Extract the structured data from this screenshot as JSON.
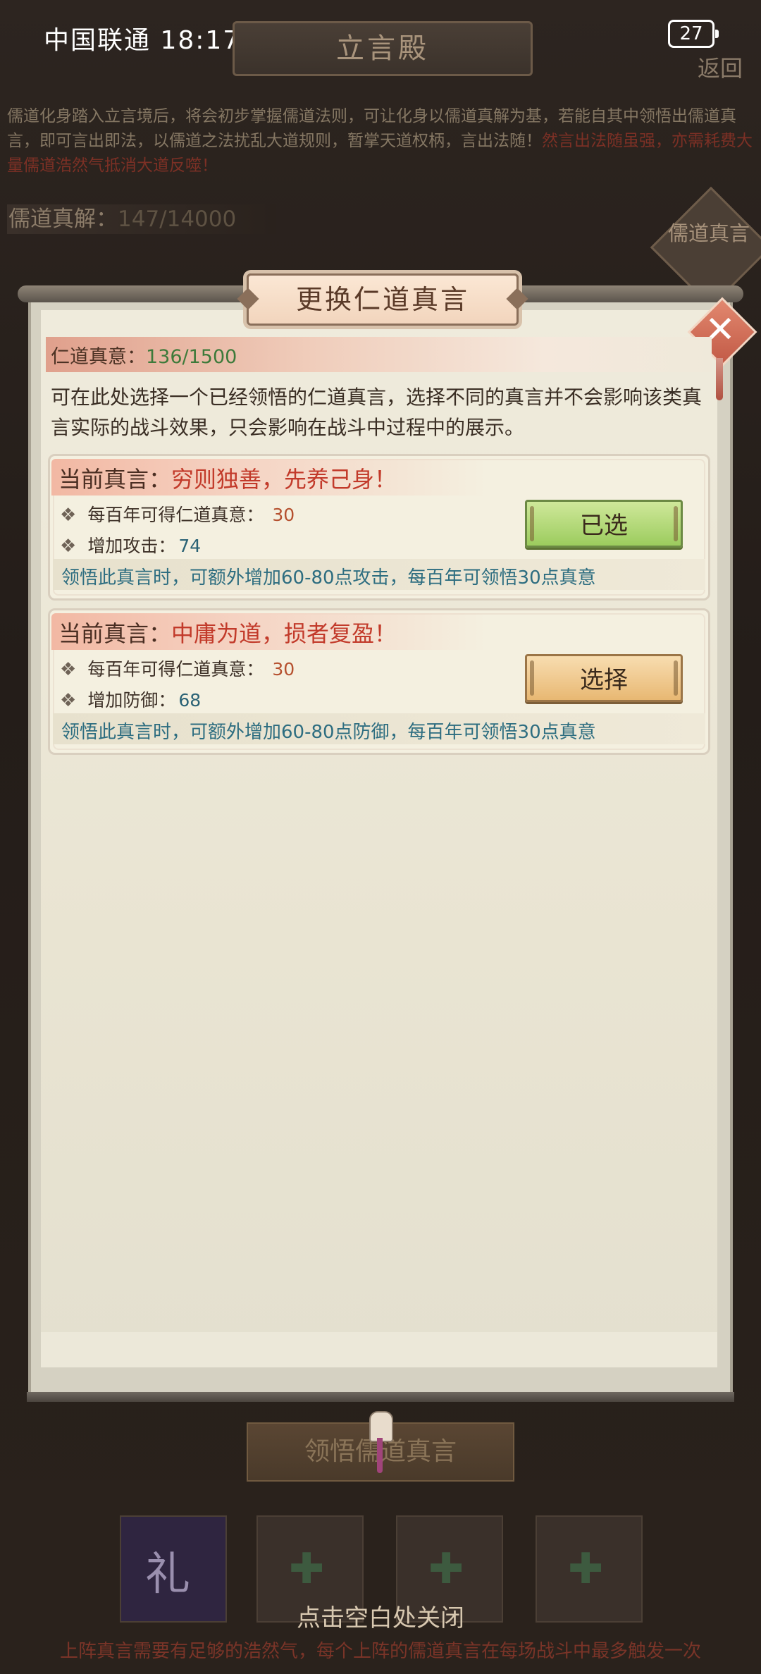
{
  "status_bar": {
    "carrier_time": "中国联通 18:17",
    "battery": "27"
  },
  "background": {
    "title": "立言殿",
    "back": "返回",
    "intro": "儒道化身踏入立言境后，将会初步掌握儒道法则，可让化身以儒道真解为基，若能自其中领悟出儒道真言，即可言出即法，以儒道之法扰乱大道规则，暂掌天道权柄，言出法随！",
    "intro_warning": "然言出法随虽强，亦需耗费大量儒道浩然气抵消大道反噬！",
    "rudao_label": "儒道真解：",
    "rudao_value": "147/14000",
    "rudao_badge": "儒道真言",
    "learn_button": "领悟儒道真言",
    "close_tip": "点击空白处关闭",
    "bottom_text": "上阵真言需要有足够的浩然气，每个上阵的儒道真言在每场战斗中最多触发一次"
  },
  "modal": {
    "title": "更换仁道真言",
    "truth_label": "仁道真意：",
    "truth_value": "136/1500",
    "description": "可在此处选择一个已经领悟的仁道真言，选择不同的真言并不会影响该类真言实际的战斗效果，只会影响在战斗中过程中的展示。",
    "cards": [
      {
        "title_prefix": "当前真言：",
        "quote": "穷则独善，先养己身！",
        "row1_label": "每百年可得仁道真意：",
        "row1_value": "30",
        "row2_label": "增加攻击：",
        "row2_value": "74",
        "footer": "领悟此真言时，可额外增加60-80点攻击，每百年可领悟30点真意",
        "button": "已选",
        "state": "selected"
      },
      {
        "title_prefix": "当前真言：",
        "quote": "中庸为道，损者复盈！",
        "row1_label": "每百年可得仁道真意：",
        "row1_value": "30",
        "row2_label": "增加防御：",
        "row2_value": "68",
        "footer": "领悟此真言时，可额外增加60-80点防御，每百年可领悟30点真意",
        "button": "选择",
        "state": "available"
      }
    ],
    "icons": {
      "close": "close-icon",
      "bullet": "diamond-bullet-icon"
    },
    "colors": {
      "selected_button": "#9ccc5e",
      "select_button": "#e8b873",
      "quote": "#c23a2a",
      "footer_text": "#2d6d80"
    }
  }
}
